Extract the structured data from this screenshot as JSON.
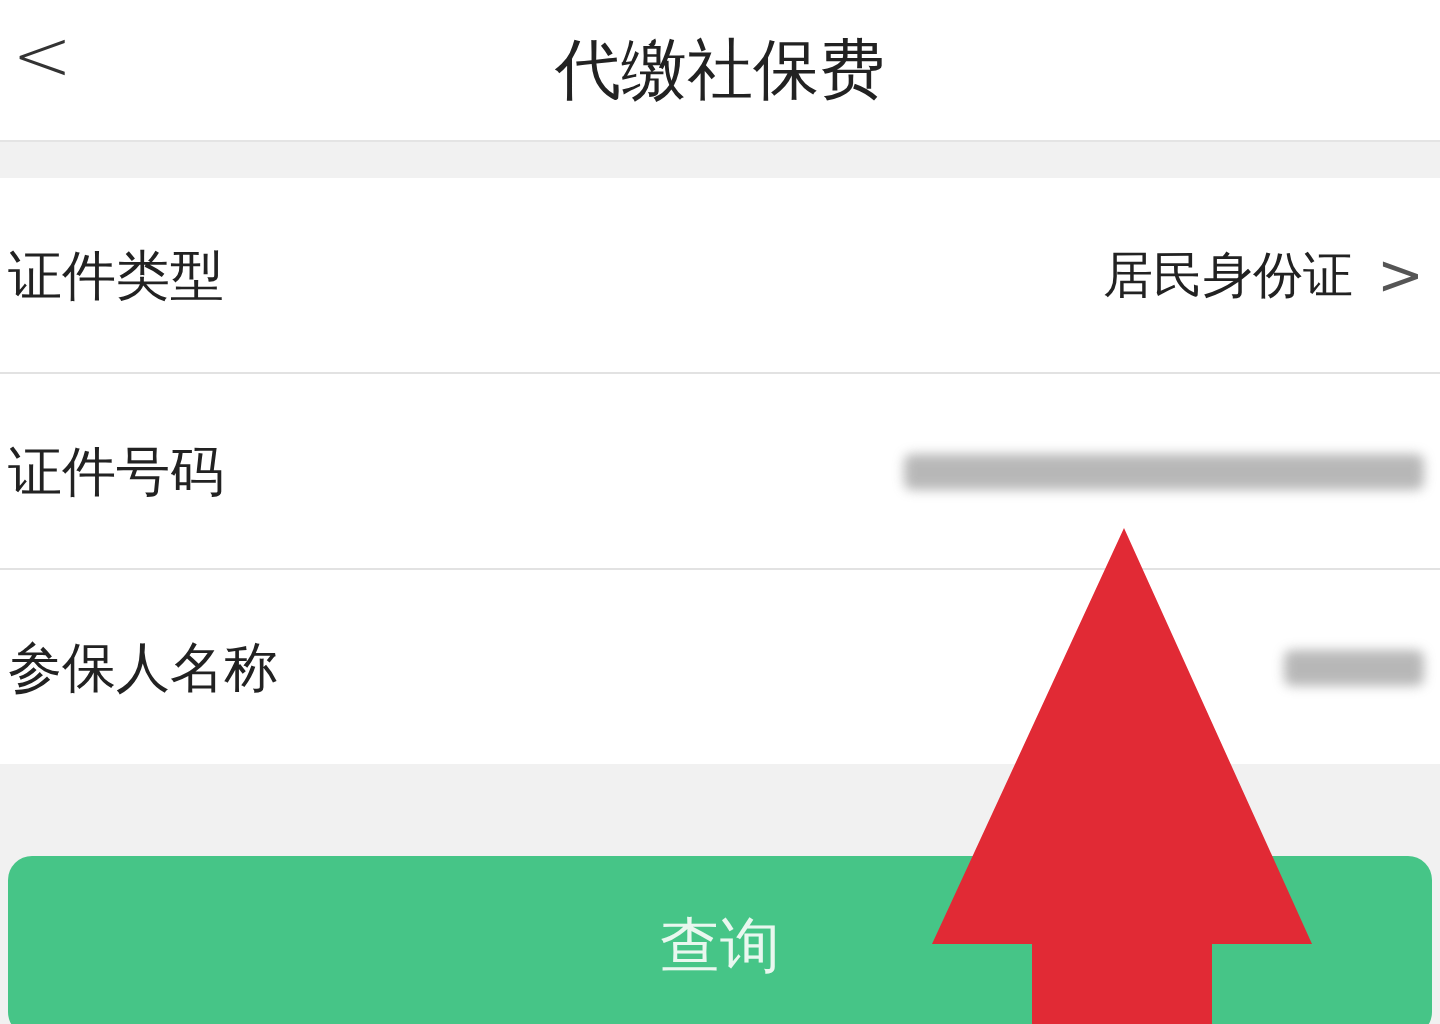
{
  "header": {
    "back": "<",
    "title": "代缴社保费"
  },
  "rows": [
    {
      "kind": "select",
      "label": "证件类型",
      "value": "居民身份证",
      "chevron": ">"
    },
    {
      "kind": "blurred",
      "label": "证件号码"
    },
    {
      "kind": "blurred",
      "label": "参保人名称"
    }
  ],
  "button": {
    "label": "查询"
  }
}
